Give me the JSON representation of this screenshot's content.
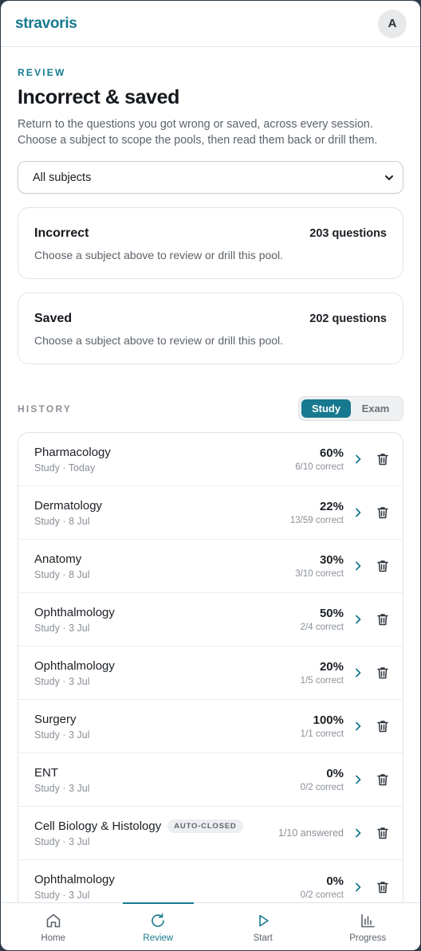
{
  "app": {
    "brand": "stravoris",
    "avatar_initial": "A"
  },
  "header": {
    "eyebrow": "REVIEW",
    "title": "Incorrect & saved",
    "description": "Return to the questions you got wrong or saved, across every session. Choose a subject to scope the pools, then read them back or drill them."
  },
  "subject_select": {
    "selected": "All subjects"
  },
  "pools": [
    {
      "name": "Incorrect",
      "count": "203 questions",
      "hint": "Choose a subject above to review or drill this pool."
    },
    {
      "name": "Saved",
      "count": "202 questions",
      "hint": "Choose a subject above to review or drill this pool."
    }
  ],
  "history": {
    "label": "HISTORY",
    "tabs": [
      {
        "label": "Study",
        "active": true
      },
      {
        "label": "Exam",
        "active": false
      }
    ],
    "items": [
      {
        "subject": "Pharmacology",
        "meta": "Study · Today",
        "score": "60%",
        "detail": "6/10 correct"
      },
      {
        "subject": "Dermatology",
        "meta": "Study · 8 Jul",
        "score": "22%",
        "detail": "13/59 correct"
      },
      {
        "subject": "Anatomy",
        "meta": "Study · 8 Jul",
        "score": "30%",
        "detail": "3/10 correct"
      },
      {
        "subject": "Ophthalmology",
        "meta": "Study · 3 Jul",
        "score": "50%",
        "detail": "2/4 correct"
      },
      {
        "subject": "Ophthalmology",
        "meta": "Study · 3 Jul",
        "score": "20%",
        "detail": "1/5 correct"
      },
      {
        "subject": "Surgery",
        "meta": "Study · 3 Jul",
        "score": "100%",
        "detail": "1/1 correct"
      },
      {
        "subject": "ENT",
        "meta": "Study · 3 Jul",
        "score": "0%",
        "detail": "0/2 correct"
      },
      {
        "subject": "Cell Biology & Histology",
        "badge": "AUTO-CLOSED",
        "meta": "Study · 3 Jul",
        "answered": "1/10 answered"
      },
      {
        "subject": "Ophthalmology",
        "meta": "Study · 3 Jul",
        "score": "0%",
        "detail": "0/2 correct"
      }
    ]
  },
  "nav": [
    {
      "label": "Home",
      "icon": "home-icon",
      "active": false
    },
    {
      "label": "Review",
      "icon": "refresh-icon",
      "active": true
    },
    {
      "label": "Start",
      "icon": "play-icon",
      "active": false
    },
    {
      "label": "Progress",
      "icon": "bar-chart-icon",
      "active": false
    }
  ],
  "colors": {
    "accent": "#16798f",
    "muted_text": "#5c636b",
    "border": "#dfe3e7"
  }
}
